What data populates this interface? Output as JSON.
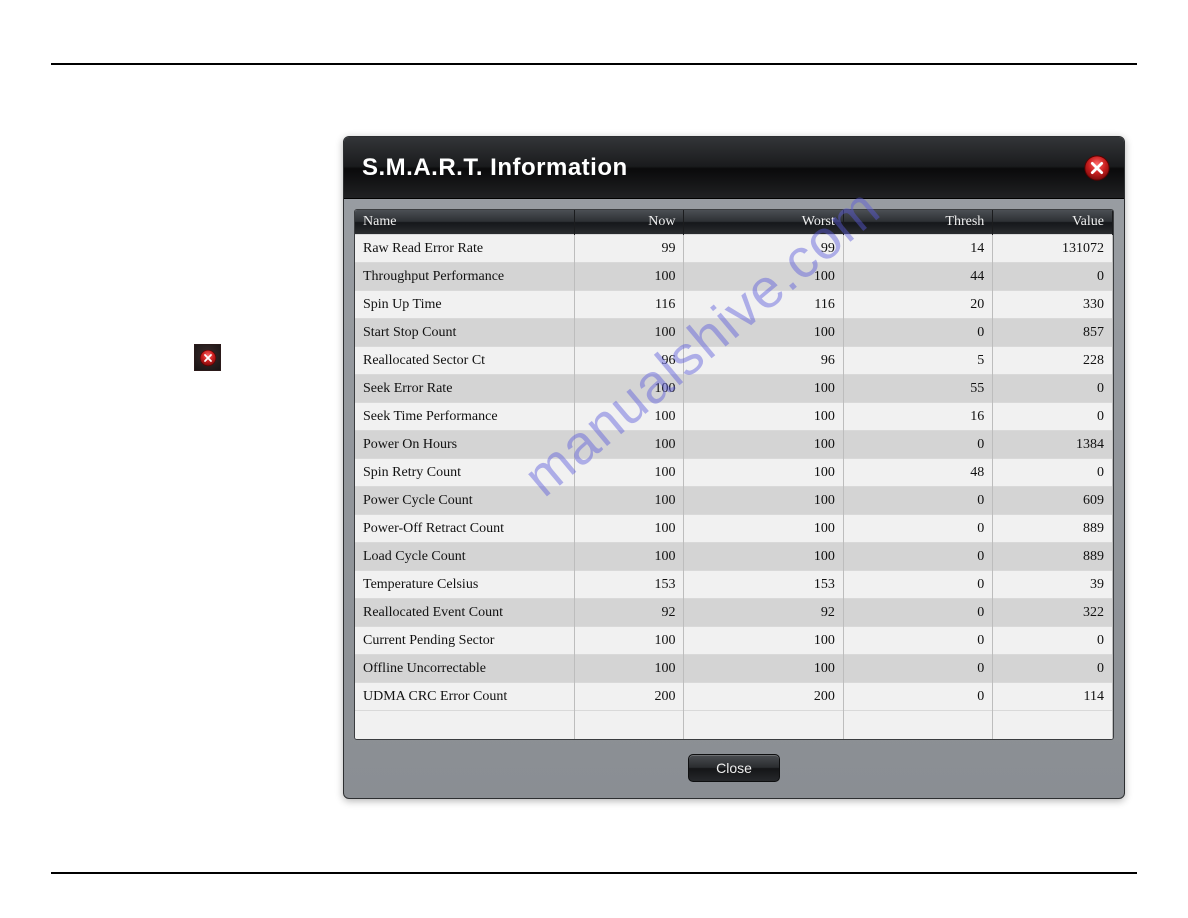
{
  "watermark": "manualshive.com",
  "dialog": {
    "title": "S.M.A.R.T. Information",
    "close_label": "Close",
    "columns": [
      "Name",
      "Now",
      "Worst",
      "Thresh",
      "Value"
    ],
    "rows": [
      {
        "name": "Raw Read Error Rate",
        "now": 99,
        "worst": 99,
        "thresh": 14,
        "value": 131072
      },
      {
        "name": "Throughput Performance",
        "now": 100,
        "worst": 100,
        "thresh": 44,
        "value": 0
      },
      {
        "name": "Spin Up Time",
        "now": 116,
        "worst": 116,
        "thresh": 20,
        "value": 330
      },
      {
        "name": "Start Stop Count",
        "now": 100,
        "worst": 100,
        "thresh": 0,
        "value": 857
      },
      {
        "name": "Reallocated Sector Ct",
        "now": 96,
        "worst": 96,
        "thresh": 5,
        "value": 228
      },
      {
        "name": "Seek Error Rate",
        "now": 100,
        "worst": 100,
        "thresh": 55,
        "value": 0
      },
      {
        "name": "Seek Time Performance",
        "now": 100,
        "worst": 100,
        "thresh": 16,
        "value": 0
      },
      {
        "name": "Power On Hours",
        "now": 100,
        "worst": 100,
        "thresh": 0,
        "value": 1384
      },
      {
        "name": "Spin Retry Count",
        "now": 100,
        "worst": 100,
        "thresh": 48,
        "value": 0
      },
      {
        "name": "Power Cycle Count",
        "now": 100,
        "worst": 100,
        "thresh": 0,
        "value": 609
      },
      {
        "name": "Power-Off Retract Count",
        "now": 100,
        "worst": 100,
        "thresh": 0,
        "value": 889
      },
      {
        "name": "Load Cycle Count",
        "now": 100,
        "worst": 100,
        "thresh": 0,
        "value": 889
      },
      {
        "name": "Temperature Celsius",
        "now": 153,
        "worst": 153,
        "thresh": 0,
        "value": 39
      },
      {
        "name": "Reallocated Event Count",
        "now": 92,
        "worst": 92,
        "thresh": 0,
        "value": 322
      },
      {
        "name": "Current Pending Sector",
        "now": 100,
        "worst": 100,
        "thresh": 0,
        "value": 0
      },
      {
        "name": "Offline Uncorrectable",
        "now": 100,
        "worst": 100,
        "thresh": 0,
        "value": 0
      },
      {
        "name": "UDMA CRC Error Count",
        "now": 200,
        "worst": 200,
        "thresh": 0,
        "value": 114
      }
    ]
  }
}
